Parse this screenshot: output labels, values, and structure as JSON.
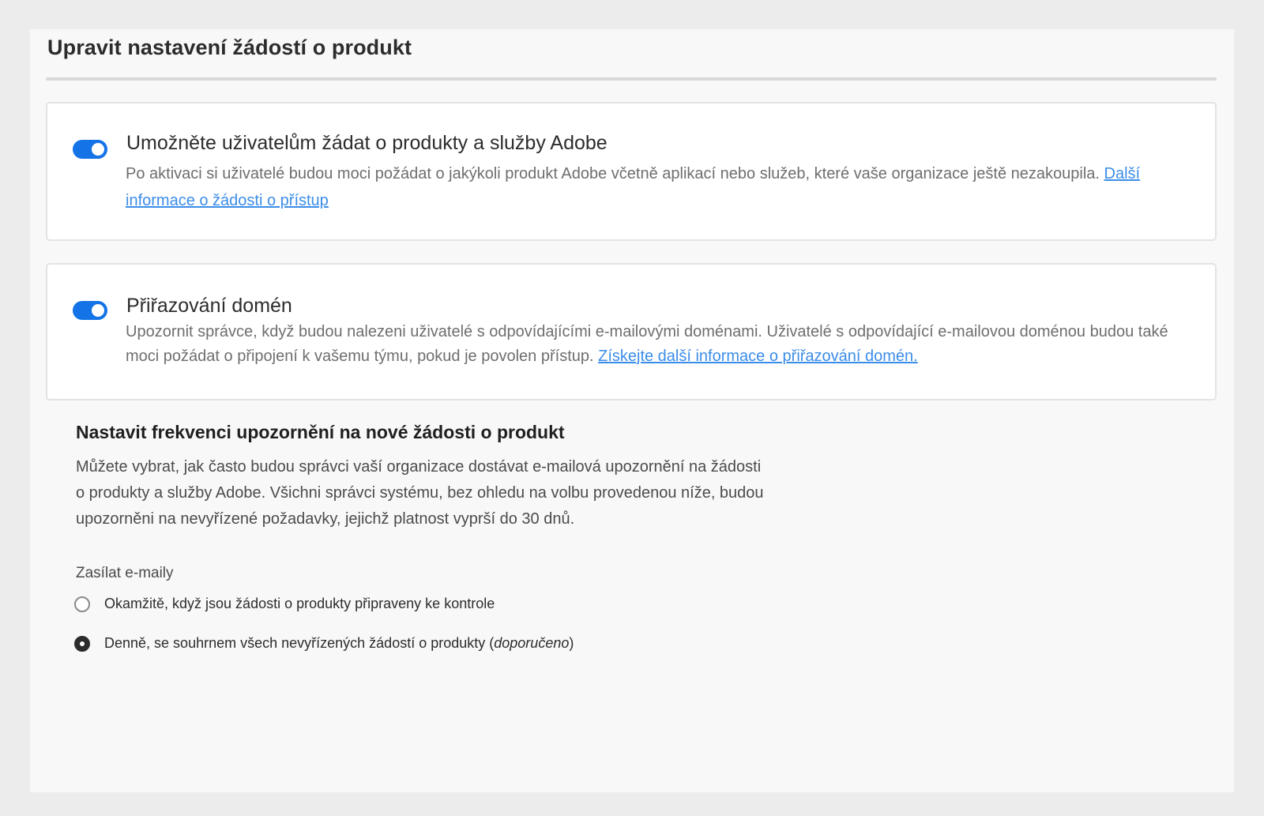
{
  "page": {
    "title": "Upravit nastavení žádostí o produkt"
  },
  "product_requests": {
    "enabled": true,
    "title": "Umožněte uživatelům žádat o produkty a služby Adobe",
    "description": "Po aktivaci si uživatelé budou moci požádat o jakýkoli produkt Adobe včetně aplikací nebo služeb, které vaše organizace ještě nezakoupila. ",
    "link": "Další informace o žádosti o přístup"
  },
  "domain_assignment": {
    "enabled": true,
    "title": "Přiřazování domén",
    "description": "Upozornit správce, když budou nalezeni uživatelé s odpovídajícími e-mailovými doménami. Uživatelé s odpovídající e-mailovou doménou budou také moci požádat o připojení k vašemu týmu, pokud je povolen přístup. ",
    "link": "Získejte další informace o přiřazování domén."
  },
  "notification_frequency": {
    "title": "Nastavit frekvenci upozornění na nové žádosti o produkt",
    "description": "Můžete vybrat, jak často budou správci vaší organizace dostávat e-mailová upozornění na žádosti o produkty a služby Adobe. Všichni správci systému, bez ohledu na volbu provedenou níže, budou upozorněni na nevyřízené požadavky, jejichž platnost vyprší do 30 dnů.",
    "field_label": "Zasílat e-maily",
    "options": [
      {
        "label": "Okamžitě, když jsou žádosti o produkty připraveny ke kontrole",
        "selected": false
      },
      {
        "label": "Denně, se souhrnem všech nevyřízených žádostí o produkty (",
        "label_emphasis": "doporučeno",
        "label_suffix": ")",
        "selected": true
      }
    ]
  },
  "colors": {
    "accent": "#1473e6",
    "link": "#3b8de8",
    "background": "#ececec",
    "panel": "#f8f8f8"
  }
}
